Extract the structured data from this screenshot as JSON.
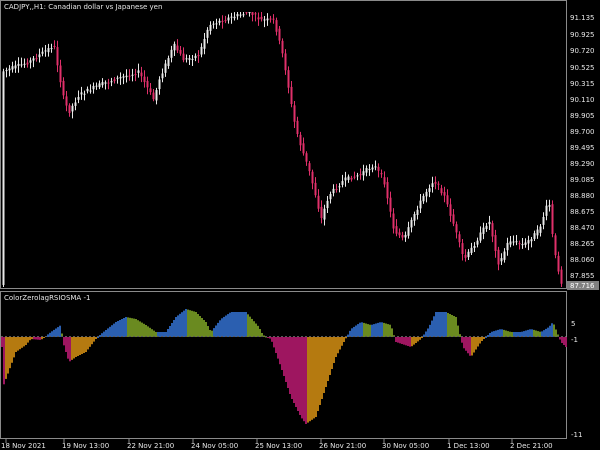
{
  "main_panel": {
    "header": "CADJPY,,H1:  Canadian dollar vs Japanese yen",
    "price_labels": [
      "91.135",
      "90.925",
      "90.720",
      "90.525",
      "90.315",
      "90.110",
      "89.905",
      "89.700",
      "89.495",
      "89.290",
      "89.085",
      "88.880",
      "88.675",
      "88.470",
      "88.265",
      "88.060",
      "87.855"
    ],
    "current_price": "87.716",
    "current_price_color": "#808080",
    "bull_color": "#e8e8e8",
    "bear_color": "#e0306a"
  },
  "indicator_panel": {
    "header": "ColorZerolagRSIOSMA -1",
    "scale_labels": [
      "5",
      "-1",
      "-11"
    ],
    "colors": {
      "blue": "#2b5fb0",
      "olive": "#6a8a20",
      "orange": "#b57a10",
      "magenta": "#9e1660"
    }
  },
  "time_axis": {
    "labels": [
      "18 Nov 2021",
      "19 Nov 13:00",
      "22 Nov 21:00",
      "24 Nov 05:00",
      "25 Nov 13:00",
      "26 Nov 21:00",
      "30 Nov 05:00",
      "1 Dec 13:00",
      "2 Dec 21:00"
    ]
  }
}
